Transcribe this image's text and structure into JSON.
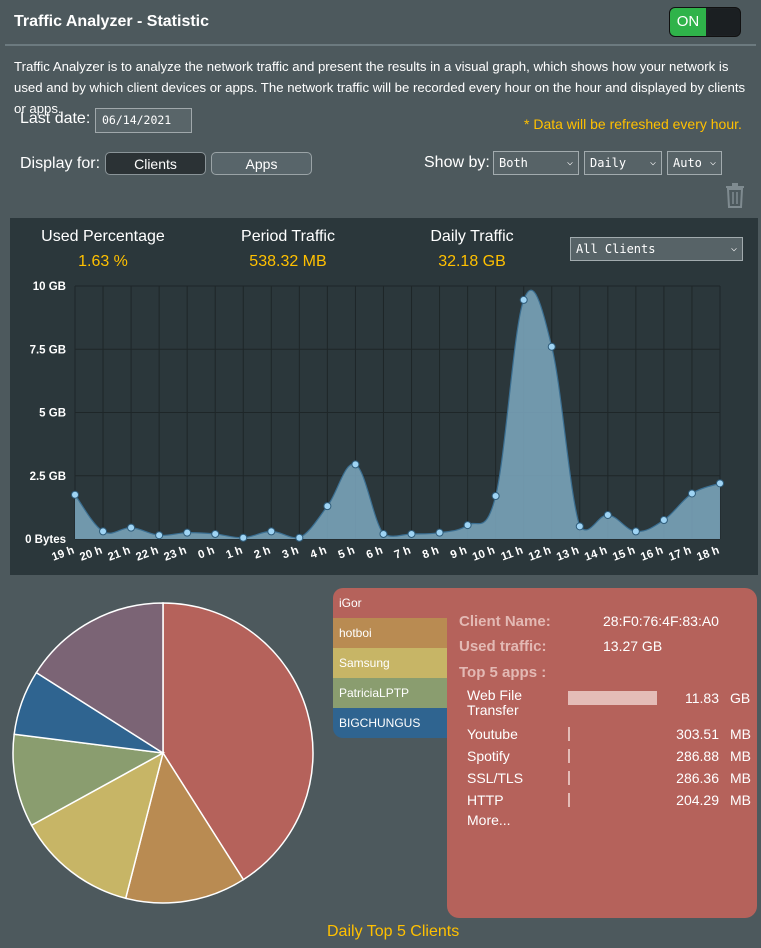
{
  "header": {
    "title": "Traffic Analyzer - Statistic",
    "toggle_label": "ON"
  },
  "description": "Traffic Analyzer is to analyze the network traffic and present the results in a visual graph, which shows how your network is used and by which client devices or apps. The network traffic will be recorded every hour on the hour and displayed by clients or apps.",
  "last_date": {
    "label": "Last date:",
    "value": "06/14/2021"
  },
  "refresh_note": "* Data will be refreshed every hour.",
  "display_for": {
    "label": "Display for:",
    "clients": "Clients",
    "apps": "Apps",
    "selected": "Clients"
  },
  "show_by": {
    "label": "Show by:",
    "direction": "Both",
    "period": "Daily",
    "unit": "Auto"
  },
  "stats": {
    "used_percentage": {
      "label": "Used Percentage",
      "value": "1.63 %"
    },
    "period_traffic": {
      "label": "Period Traffic",
      "value": "538.32 MB"
    },
    "daily_traffic": {
      "label": "Daily Traffic",
      "value": "32.18 GB"
    },
    "client_filter": "All Clients"
  },
  "chart_data": {
    "type": "area",
    "y_tick_labels": [
      "0 Bytes",
      "2.5 GB",
      "5 GB",
      "7.5 GB",
      "10 GB"
    ],
    "y_ticks": [
      0,
      2.5,
      5,
      7.5,
      10
    ],
    "ylim": [
      0,
      10
    ],
    "categories": [
      "19 h",
      "20 h",
      "21 h",
      "22 h",
      "23 h",
      "0 h",
      "1 h",
      "2 h",
      "3 h",
      "4 h",
      "5 h",
      "6 h",
      "7 h",
      "8 h",
      "9 h",
      "10 h",
      "11 h",
      "12 h",
      "13 h",
      "14 h",
      "15 h",
      "16 h",
      "17 h",
      "18 h"
    ],
    "values": [
      1.75,
      0.3,
      0.45,
      0.15,
      0.25,
      0.2,
      0.05,
      0.3,
      0.05,
      1.3,
      2.95,
      0.2,
      0.2,
      0.25,
      0.55,
      1.7,
      9.45,
      7.6,
      0.5,
      0.95,
      0.3,
      0.75,
      1.8,
      2.2
    ],
    "grid": true,
    "color": "#7ea9c1"
  },
  "clients": [
    {
      "name": "iGor",
      "color": "#b5625b",
      "share": 0.41
    },
    {
      "name": "hotboi",
      "color": "#b98b52",
      "share": 0.13
    },
    {
      "name": "Samsung",
      "color": "#c7b566",
      "share": 0.13
    },
    {
      "name": "PatriciaLPTP",
      "color": "#8a9d6f",
      "share": 0.1
    },
    {
      "name": "BIGCHUNGUS",
      "color": "#2f6490",
      "share": 0.07
    },
    {
      "name": "",
      "color": "#7b6475",
      "share": 0.16
    }
  ],
  "detail": {
    "client_name_label": "Client Name:",
    "client_name": "28:F0:76:4F:83:A0",
    "used_traffic_label": "Used traffic:",
    "used_traffic": "13.27 GB",
    "top_apps_label": "Top 5 apps :",
    "apps": [
      {
        "name": "Web File Transfer",
        "value": "11.83",
        "unit": "GB",
        "ratio": 0.89
      },
      {
        "name": "Youtube",
        "value": "303.51",
        "unit": "MB",
        "ratio": 0.02
      },
      {
        "name": "Spotify",
        "value": "286.88",
        "unit": "MB",
        "ratio": 0.02
      },
      {
        "name": "SSL/TLS",
        "value": "286.36",
        "unit": "MB",
        "ratio": 0.02
      },
      {
        "name": "HTTP",
        "value": "204.29",
        "unit": "MB",
        "ratio": 0.015
      }
    ],
    "more_label": "More..."
  },
  "footer": "Daily Top 5 Clients"
}
